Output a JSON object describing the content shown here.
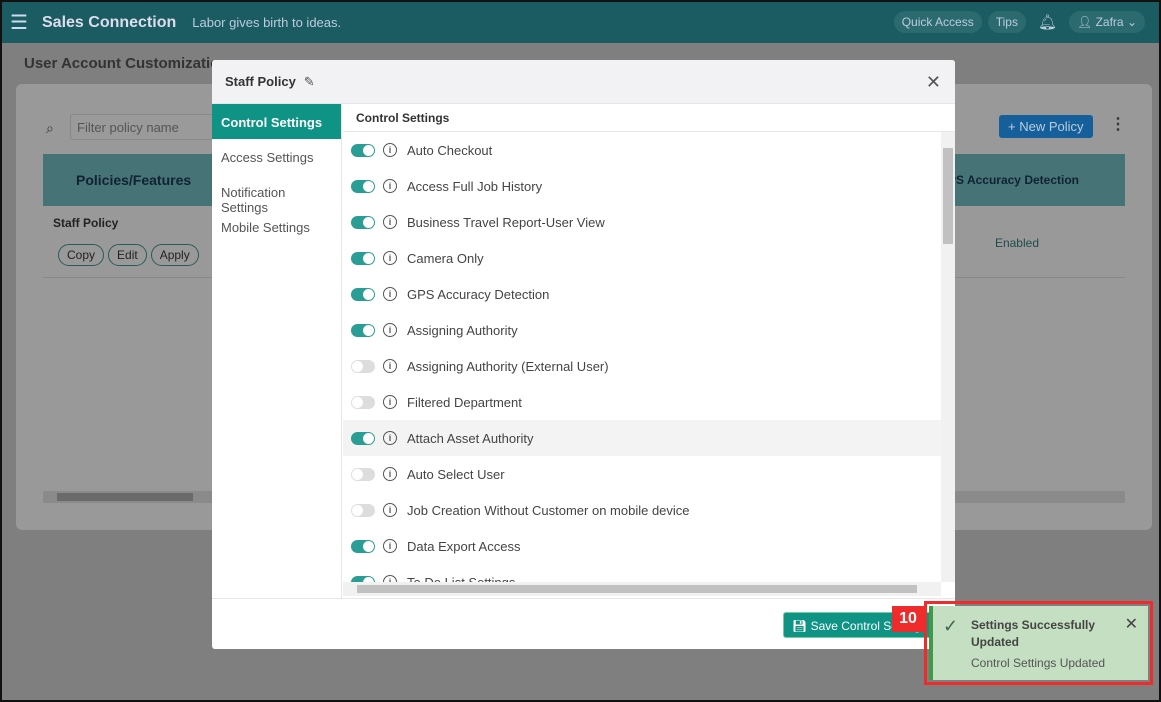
{
  "header": {
    "app": "Sales Connection",
    "tagline": "Labor gives birth to ideas.",
    "quick_access": "Quick Access",
    "tips": "Tips",
    "user": "Zafra"
  },
  "page": {
    "title": "User Account Customizatio",
    "filter_placeholder": "Filter policy name",
    "new_policy": "New Policy",
    "table": {
      "col1": "Policies/Features",
      "col2": "PS Accuracy Detection",
      "row": {
        "name": "Staff Policy",
        "copy": "Copy",
        "edit": "Edit",
        "apply": "Apply",
        "value": "Enabled"
      }
    }
  },
  "modal": {
    "title": "Staff Policy",
    "nav": [
      "Control Settings",
      "Access Settings",
      "Notification Settings",
      "Mobile Settings"
    ],
    "section": "Control Settings",
    "items": [
      {
        "label": "Auto Checkout",
        "on": true
      },
      {
        "label": "Access Full Job History",
        "on": true
      },
      {
        "label": "Business Travel Report-User View",
        "on": true
      },
      {
        "label": "Camera Only",
        "on": true
      },
      {
        "label": "GPS Accuracy Detection",
        "on": true
      },
      {
        "label": "Assigning Authority",
        "on": true
      },
      {
        "label": "Assigning Authority (External User)",
        "on": false
      },
      {
        "label": "Filtered Department",
        "on": false
      },
      {
        "label": "Attach Asset Authority",
        "on": true
      },
      {
        "label": "Auto Select User",
        "on": false
      },
      {
        "label": "Job Creation Without Customer on mobile device",
        "on": false
      },
      {
        "label": "Data Export Access",
        "on": true
      },
      {
        "label": "To Do List Settings",
        "on": true
      }
    ],
    "save": "Save Control Settings"
  },
  "toast": {
    "title": "Settings Successfully Updated",
    "message": "Control Settings Updated",
    "badge": "10"
  },
  "colors": {
    "accent": "#0e9385",
    "toast": "#c4dfc2",
    "highlight": "#ee2c2c"
  }
}
